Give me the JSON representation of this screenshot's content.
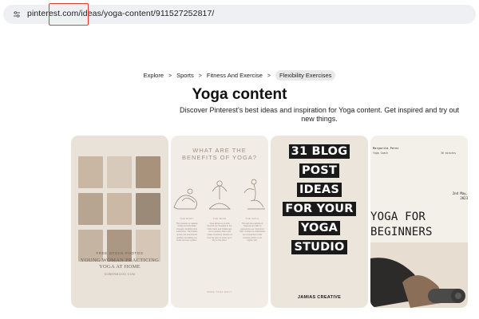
{
  "browser": {
    "url_prefix": "pinterest.com",
    "url_rest": "/ideas/yoga-content/911527252817/",
    "site_icon": "tune-icon"
  },
  "breadcrumb": {
    "items": [
      "Explore",
      "Sports",
      "Fitness And Exercise"
    ],
    "active": "Flexibility Exercises",
    "separator": ">"
  },
  "page": {
    "title": "Yoga content",
    "subtitle": "Discover Pinterest's best ideas and inspiration for Yoga content. Get inspired and try out new things."
  },
  "pins": {
    "pin1": {
      "caption_small": "FREE STOCK PHOTOS",
      "caption_main": "YOUNG WOMAN PRACTICING YOGA AT HOME",
      "caption_site": "SOBERMOOD.COM"
    },
    "pin2": {
      "title": "WHAT ARE THE BENEFITS OF YOGA?",
      "columns": [
        {
          "head": "THE BODY",
          "text": "The postures or asanas create and stimulate strength, flexibility and endurance. The bodies nerves are stretched & purified, benefiting our entire nervous system."
        },
        {
          "head": "THE MIND",
          "text": "Yoga allows us to look beyond our thoughts to the other hand and challenges us to question them and make conscious choices of how we want to show up in life on the other."
        },
        {
          "head": "THE SOUL",
          "text": "Through the practice of Yoga we are able to experience our innermost Self. It helps us understand our connection to the universe which is our higher self."
        }
      ],
      "footer": "MAKE YOGA DAILY"
    },
    "pin3": {
      "lines": [
        "31 BLOG",
        "POST",
        "IDEAS",
        "FOR YOUR",
        "YOGA",
        "STUDIO"
      ],
      "brand": "JAMIAS CREATIVE"
    },
    "pin4": {
      "name": "Margarita Perez",
      "role": "Yoga Coach",
      "duration": "30 minutes",
      "date_line1": "2nd May,",
      "date_line2": "2023",
      "headline_line1": "YOGA FOR",
      "headline_line2": "BEGINNERS"
    }
  },
  "colors": {
    "url_highlight": "#e0392b",
    "chip_bg": "#e9e9e9"
  }
}
